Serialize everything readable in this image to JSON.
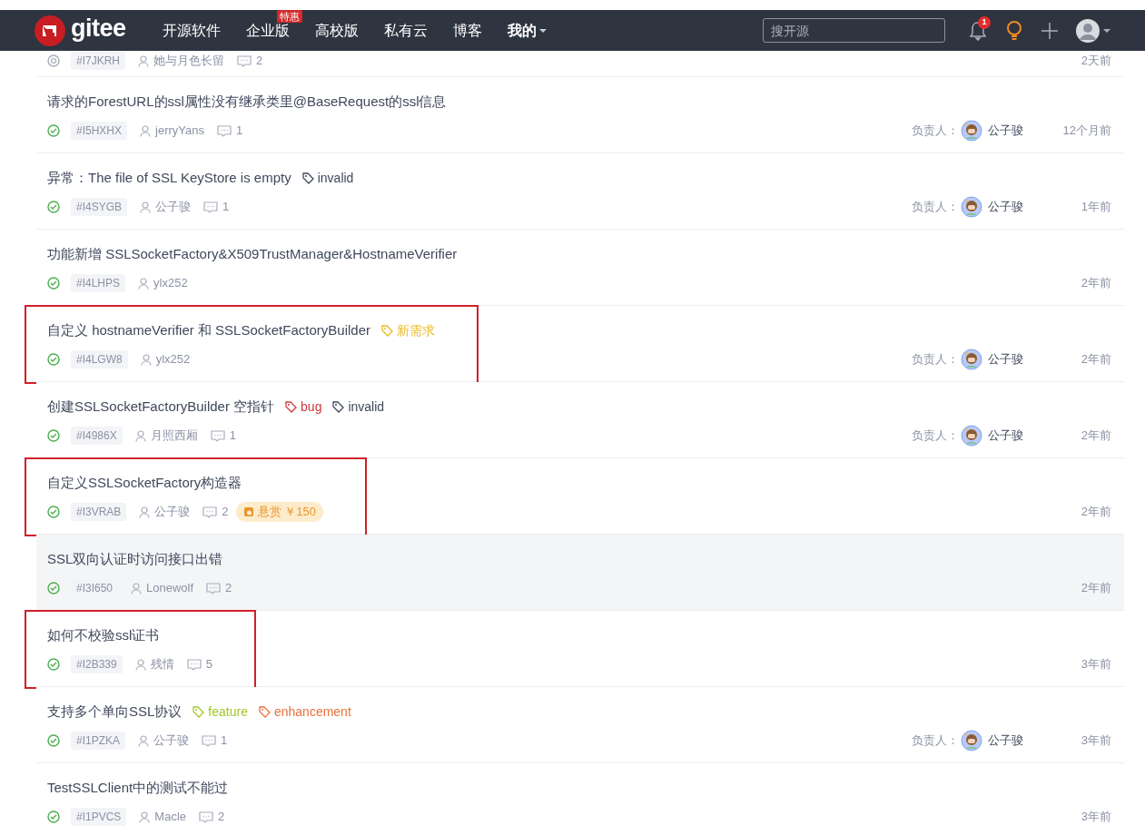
{
  "header": {
    "logo_text": "gitee",
    "nav": [
      {
        "label": "开源软件"
      },
      {
        "label": "企业版",
        "badge": "特惠"
      },
      {
        "label": "高校版"
      },
      {
        "label": "私有云"
      },
      {
        "label": "博客"
      },
      {
        "label": "我的",
        "bold": true,
        "dropdown": true
      }
    ],
    "search": {
      "placeholder": "搜开源"
    },
    "notification_count": "1"
  },
  "issues": [
    {
      "closed": false,
      "id": "#I7JKRH",
      "author": "她与月色长留",
      "comments": "2",
      "time": "2天前",
      "annotated": false
    },
    {
      "closed": true,
      "title": "请求的ForestURL的ssl属性没有继承类里@BaseRequest的ssl信息",
      "id": "#I5HXHX",
      "author": "jerryYans",
      "comments": "1",
      "assignee_label": "负责人：",
      "assignee": "公子骏",
      "time": "12个月前",
      "hovered": false,
      "annotated": false
    },
    {
      "closed": true,
      "title": "异常：The file of SSL KeyStore is empty",
      "labels": [
        {
          "text": "invalid",
          "color": "#40485b"
        }
      ],
      "id": "#I4SYGB",
      "author": "公子骏",
      "comments": "1",
      "assignee_label": "负责人：",
      "assignee": "公子骏",
      "time": "1年前",
      "hovered": false,
      "annotated": false
    },
    {
      "closed": true,
      "title": "功能新增 SSLSocketFactory&X509TrustManager&HostnameVerifier",
      "id": "#I4LHPS",
      "author": "ylx252",
      "time": "2年前",
      "hovered": false,
      "annotated": false
    },
    {
      "closed": true,
      "title": "自定义 hostnameVerifier 和 SSLSocketFactoryBuilder",
      "labels": [
        {
          "text": "新需求",
          "color": "#e8b923"
        }
      ],
      "id": "#I4LGW8",
      "author": "ylx252",
      "assignee_label": "负责人：",
      "assignee": "公子骏",
      "time": "2年前",
      "hovered": false,
      "annotated": true
    },
    {
      "closed": true,
      "title": "创建SSLSocketFactoryBuilder 空指针",
      "labels": [
        {
          "text": "bug",
          "color": "#d0393e"
        },
        {
          "text": "invalid",
          "color": "#40485b"
        }
      ],
      "id": "#I4986X",
      "author": "月照西厢",
      "comments": "1",
      "assignee_label": "负责人：",
      "assignee": "公子骏",
      "time": "2年前",
      "hovered": false,
      "annotated": false
    },
    {
      "closed": true,
      "title": "自定义SSLSocketFactory构造器",
      "id": "#I3VRAB",
      "author": "公子骏",
      "comments": "2",
      "bounty": "悬赏 ￥150",
      "time": "2年前",
      "hovered": false,
      "annotated": true
    },
    {
      "closed": true,
      "title": "SSL双向认证时访问接口出错",
      "id": "#I3I650",
      "author": "Lonewolf",
      "comments": "2",
      "time": "2年前",
      "hovered": true,
      "annotated": false
    },
    {
      "closed": true,
      "title": "如何不校验ssl证书",
      "id": "#I2B339",
      "author": "残情",
      "comments": "5",
      "time": "3年前",
      "hovered": false,
      "annotated": true
    },
    {
      "closed": true,
      "title": "支持多个单向SSL协议",
      "labels": [
        {
          "text": "feature",
          "color": "#a3c62c"
        },
        {
          "text": "enhancement",
          "color": "#e8713c"
        }
      ],
      "id": "#I1PZKA",
      "author": "公子骏",
      "comments": "1",
      "assignee_label": "负责人：",
      "assignee": "公子骏",
      "time": "3年前",
      "hovered": false,
      "annotated": false
    },
    {
      "closed": true,
      "title": "TestSSLClient中的测试不能过",
      "id": "#I1PVCS",
      "author": "Macle",
      "comments": "2",
      "time": "3年前",
      "hovered": false,
      "annotated": false
    }
  ]
}
